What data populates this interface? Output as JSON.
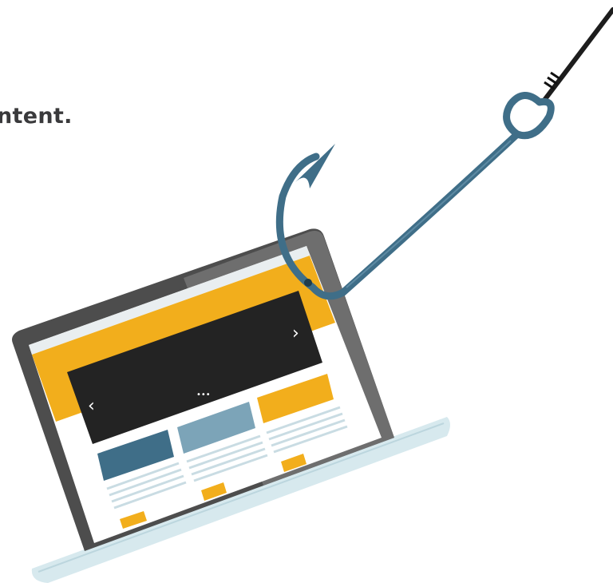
{
  "heading": {
    "text": "ntent."
  },
  "illustration": {
    "subject": "fishing-hook-on-laptop",
    "colors": {
      "hook": "#3f6e88",
      "hook_highlight": "#5d8aa3",
      "line": "#1d1d1d",
      "laptop_bezel": "#4a4a4a",
      "laptop_base": "#cfe4ea",
      "site_banner": "#f2ae1c",
      "site_slider": "#222222",
      "card_blue_dark": "#3f6e88",
      "card_blue_light": "#7ca4b8",
      "card_yellow": "#f2ae1c",
      "text_line": "#c9dce3"
    },
    "slider": {
      "prev_label": "‹",
      "next_label": "›",
      "dots_label": "•••"
    }
  }
}
